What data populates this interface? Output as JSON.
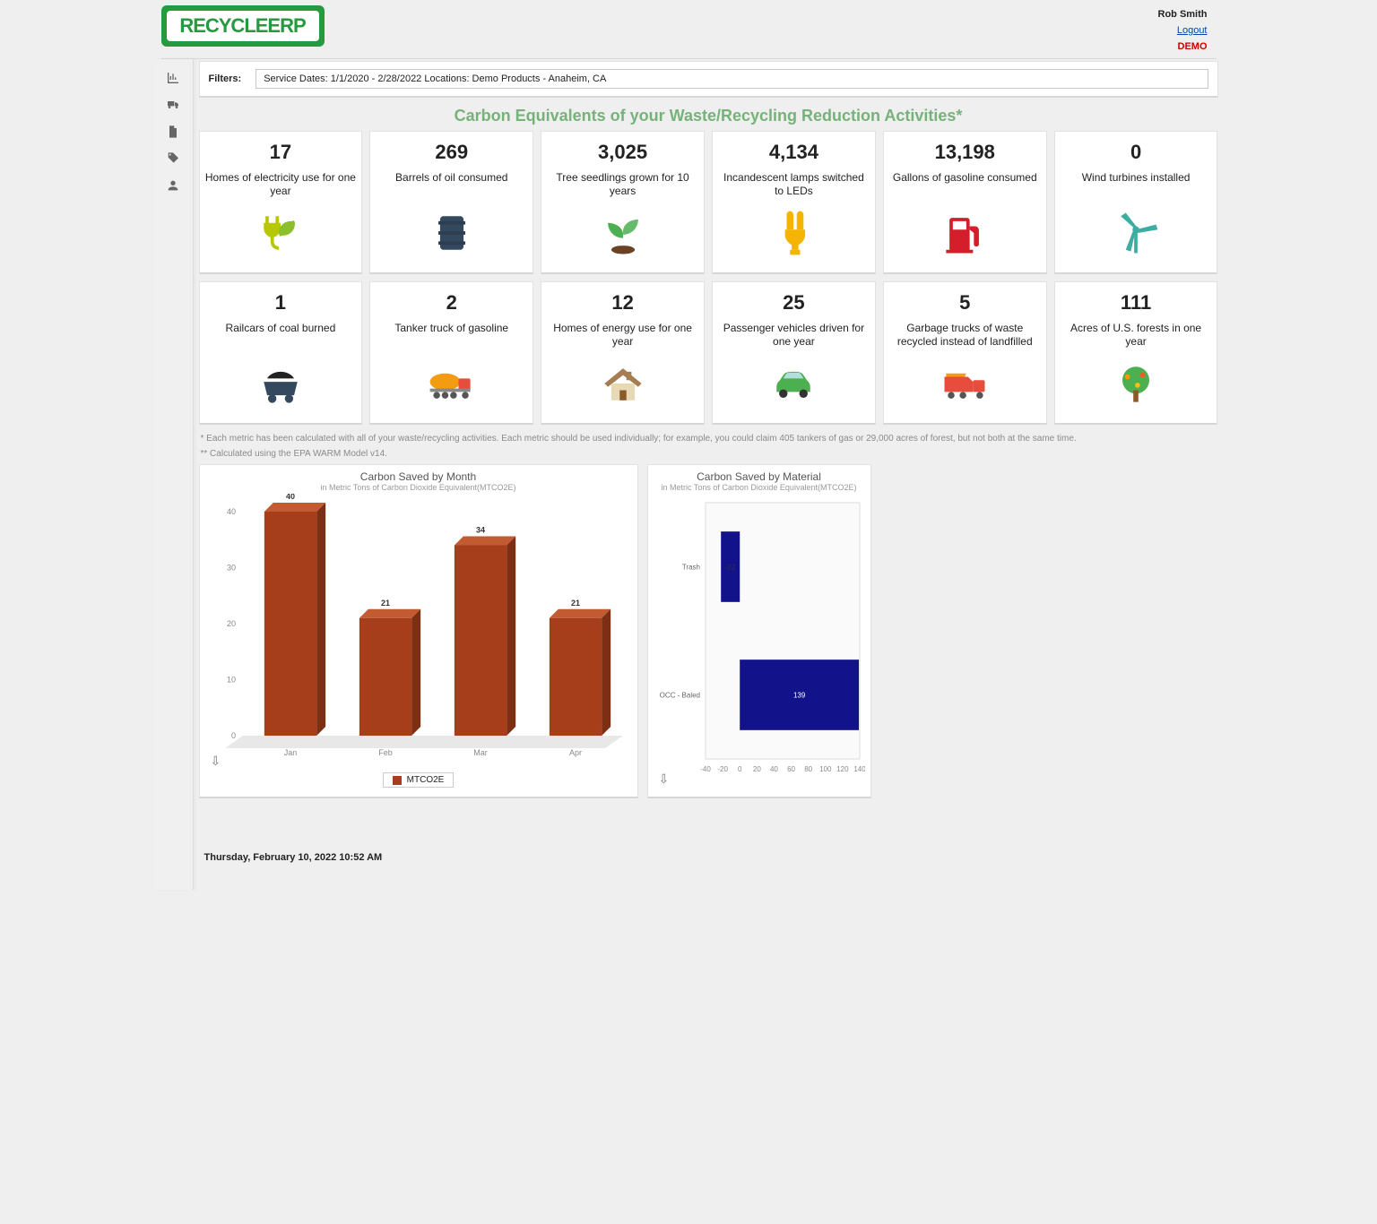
{
  "header": {
    "logo_text": "RECYCLEERP",
    "user_name": "Rob Smith",
    "logout_label": "Logout",
    "demo_label": "DEMO"
  },
  "sidebar": {
    "items": [
      {
        "name": "chart-bar-icon"
      },
      {
        "name": "truck-icon"
      },
      {
        "name": "document-icon"
      },
      {
        "name": "tag-icon"
      },
      {
        "name": "user-icon"
      }
    ]
  },
  "filter": {
    "label": "Filters:",
    "value": "Service Dates:  1/1/2020 - 2/28/2022   Locations: Demo Products - Anaheim, CA"
  },
  "page_title": "Carbon Equivalents of your Waste/Recycling Reduction Activities*",
  "metrics": [
    {
      "value": "17",
      "label": "Homes of electricity use for one year",
      "icon": "plug-leaf-icon",
      "color": "#b6c800"
    },
    {
      "value": "269",
      "label": "Barrels of oil consumed",
      "icon": "barrel-icon",
      "color": "#34495e"
    },
    {
      "value": "3,025",
      "label": "Tree seedlings grown for 10 years",
      "icon": "seedling-icon",
      "color": "#4caf50"
    },
    {
      "value": "4,134",
      "label": "Incandescent lamps switched to LEDs",
      "icon": "cfl-bulb-icon",
      "color": "#f4b400"
    },
    {
      "value": "13,198",
      "label": "Gallons of gasoline consumed",
      "icon": "gas-pump-icon",
      "color": "#d41e2c"
    },
    {
      "value": "0",
      "label": "Wind turbines installed",
      "icon": "wind-turbine-icon",
      "color": "#3cada0"
    },
    {
      "value": "1",
      "label": "Railcars of coal burned",
      "icon": "railcar-icon",
      "color": "#34495e"
    },
    {
      "value": "2",
      "label": "Tanker truck of gasoline",
      "icon": "tanker-truck-icon",
      "color": "#f39c12"
    },
    {
      "value": "12",
      "label": "Homes of energy use for one year",
      "icon": "house-icon",
      "color": "#7f6a4a"
    },
    {
      "value": "25",
      "label": "Passenger vehicles driven for one year",
      "icon": "car-icon",
      "color": "#4caf50"
    },
    {
      "value": "5",
      "label": "Garbage trucks of waste recycled instead of landfilled",
      "icon": "garbage-truck-icon",
      "color": "#e74c3c"
    },
    {
      "value": "111",
      "label": "Acres of U.S. forests in one year",
      "icon": "tree-icon",
      "color": "#4caf50"
    }
  ],
  "footnotes": [
    "* Each metric has been calculated with all of your waste/recycling activities. Each metric should be used individually; for example, you could claim 405 tankers of gas or 29,000 acres of forest, but not both at the same time.",
    "** Calculated using the EPA WARM Model v14."
  ],
  "chart_month": {
    "title": "Carbon Saved by Month",
    "subtitle": "in Metric Tons of Carbon Dioxide Equivalent(MTCO2E)",
    "legend": "MTCO2E"
  },
  "chart_material": {
    "title": "Carbon Saved by Material",
    "subtitle": "in Metric Tons of Carbon Dioxide Equivalent(MTCO2E)"
  },
  "timestamp": "Thursday, February 10, 2022 10:52 AM",
  "chart_data": [
    {
      "type": "bar",
      "title": "Carbon Saved by Month",
      "subtitle": "in Metric Tons of Carbon Dioxide Equivalent(MTCO2E)",
      "categories": [
        "Jan",
        "Feb",
        "Mar",
        "Apr"
      ],
      "series": [
        {
          "name": "MTCO2E",
          "values": [
            40,
            21,
            34,
            21
          ],
          "color": "#a63e1b"
        }
      ],
      "ylabel": "",
      "xlabel": "",
      "ylim": [
        0,
        40
      ],
      "yticks": [
        0,
        10,
        20,
        30,
        40
      ]
    },
    {
      "type": "bar",
      "orientation": "horizontal",
      "title": "Carbon Saved by Material",
      "subtitle": "in Metric Tons of Carbon Dioxide Equivalent(MTCO2E)",
      "categories": [
        "Trash",
        "OCC - Baled"
      ],
      "series": [
        {
          "name": "MTCO2E",
          "values": [
            -22,
            139
          ],
          "color": "#12128a"
        }
      ],
      "xlim": [
        -40,
        140
      ],
      "xticks": [
        -40,
        -20,
        0,
        20,
        40,
        60,
        80,
        100,
        120,
        140
      ]
    }
  ]
}
